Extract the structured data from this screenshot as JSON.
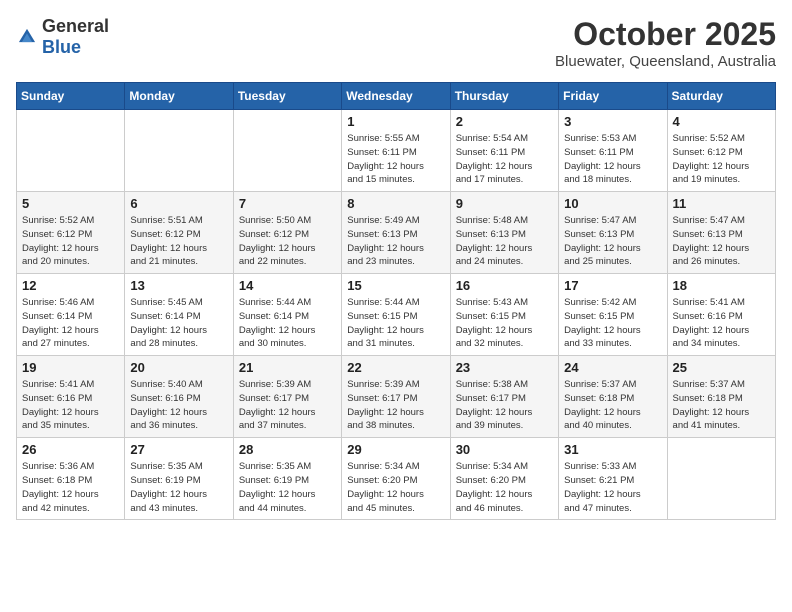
{
  "header": {
    "logo": {
      "general": "General",
      "blue": "Blue"
    },
    "title": "October 2025",
    "location": "Bluewater, Queensland, Australia"
  },
  "calendar": {
    "weekdays": [
      "Sunday",
      "Monday",
      "Tuesday",
      "Wednesday",
      "Thursday",
      "Friday",
      "Saturday"
    ],
    "weeks": [
      [
        {
          "day": "",
          "info": ""
        },
        {
          "day": "",
          "info": ""
        },
        {
          "day": "",
          "info": ""
        },
        {
          "day": "1",
          "info": "Sunrise: 5:55 AM\nSunset: 6:11 PM\nDaylight: 12 hours\nand 15 minutes."
        },
        {
          "day": "2",
          "info": "Sunrise: 5:54 AM\nSunset: 6:11 PM\nDaylight: 12 hours\nand 17 minutes."
        },
        {
          "day": "3",
          "info": "Sunrise: 5:53 AM\nSunset: 6:11 PM\nDaylight: 12 hours\nand 18 minutes."
        },
        {
          "day": "4",
          "info": "Sunrise: 5:52 AM\nSunset: 6:12 PM\nDaylight: 12 hours\nand 19 minutes."
        }
      ],
      [
        {
          "day": "5",
          "info": "Sunrise: 5:52 AM\nSunset: 6:12 PM\nDaylight: 12 hours\nand 20 minutes."
        },
        {
          "day": "6",
          "info": "Sunrise: 5:51 AM\nSunset: 6:12 PM\nDaylight: 12 hours\nand 21 minutes."
        },
        {
          "day": "7",
          "info": "Sunrise: 5:50 AM\nSunset: 6:12 PM\nDaylight: 12 hours\nand 22 minutes."
        },
        {
          "day": "8",
          "info": "Sunrise: 5:49 AM\nSunset: 6:13 PM\nDaylight: 12 hours\nand 23 minutes."
        },
        {
          "day": "9",
          "info": "Sunrise: 5:48 AM\nSunset: 6:13 PM\nDaylight: 12 hours\nand 24 minutes."
        },
        {
          "day": "10",
          "info": "Sunrise: 5:47 AM\nSunset: 6:13 PM\nDaylight: 12 hours\nand 25 minutes."
        },
        {
          "day": "11",
          "info": "Sunrise: 5:47 AM\nSunset: 6:13 PM\nDaylight: 12 hours\nand 26 minutes."
        }
      ],
      [
        {
          "day": "12",
          "info": "Sunrise: 5:46 AM\nSunset: 6:14 PM\nDaylight: 12 hours\nand 27 minutes."
        },
        {
          "day": "13",
          "info": "Sunrise: 5:45 AM\nSunset: 6:14 PM\nDaylight: 12 hours\nand 28 minutes."
        },
        {
          "day": "14",
          "info": "Sunrise: 5:44 AM\nSunset: 6:14 PM\nDaylight: 12 hours\nand 30 minutes."
        },
        {
          "day": "15",
          "info": "Sunrise: 5:44 AM\nSunset: 6:15 PM\nDaylight: 12 hours\nand 31 minutes."
        },
        {
          "day": "16",
          "info": "Sunrise: 5:43 AM\nSunset: 6:15 PM\nDaylight: 12 hours\nand 32 minutes."
        },
        {
          "day": "17",
          "info": "Sunrise: 5:42 AM\nSunset: 6:15 PM\nDaylight: 12 hours\nand 33 minutes."
        },
        {
          "day": "18",
          "info": "Sunrise: 5:41 AM\nSunset: 6:16 PM\nDaylight: 12 hours\nand 34 minutes."
        }
      ],
      [
        {
          "day": "19",
          "info": "Sunrise: 5:41 AM\nSunset: 6:16 PM\nDaylight: 12 hours\nand 35 minutes."
        },
        {
          "day": "20",
          "info": "Sunrise: 5:40 AM\nSunset: 6:16 PM\nDaylight: 12 hours\nand 36 minutes."
        },
        {
          "day": "21",
          "info": "Sunrise: 5:39 AM\nSunset: 6:17 PM\nDaylight: 12 hours\nand 37 minutes."
        },
        {
          "day": "22",
          "info": "Sunrise: 5:39 AM\nSunset: 6:17 PM\nDaylight: 12 hours\nand 38 minutes."
        },
        {
          "day": "23",
          "info": "Sunrise: 5:38 AM\nSunset: 6:17 PM\nDaylight: 12 hours\nand 39 minutes."
        },
        {
          "day": "24",
          "info": "Sunrise: 5:37 AM\nSunset: 6:18 PM\nDaylight: 12 hours\nand 40 minutes."
        },
        {
          "day": "25",
          "info": "Sunrise: 5:37 AM\nSunset: 6:18 PM\nDaylight: 12 hours\nand 41 minutes."
        }
      ],
      [
        {
          "day": "26",
          "info": "Sunrise: 5:36 AM\nSunset: 6:18 PM\nDaylight: 12 hours\nand 42 minutes."
        },
        {
          "day": "27",
          "info": "Sunrise: 5:35 AM\nSunset: 6:19 PM\nDaylight: 12 hours\nand 43 minutes."
        },
        {
          "day": "28",
          "info": "Sunrise: 5:35 AM\nSunset: 6:19 PM\nDaylight: 12 hours\nand 44 minutes."
        },
        {
          "day": "29",
          "info": "Sunrise: 5:34 AM\nSunset: 6:20 PM\nDaylight: 12 hours\nand 45 minutes."
        },
        {
          "day": "30",
          "info": "Sunrise: 5:34 AM\nSunset: 6:20 PM\nDaylight: 12 hours\nand 46 minutes."
        },
        {
          "day": "31",
          "info": "Sunrise: 5:33 AM\nSunset: 6:21 PM\nDaylight: 12 hours\nand 47 minutes."
        },
        {
          "day": "",
          "info": ""
        }
      ]
    ]
  }
}
